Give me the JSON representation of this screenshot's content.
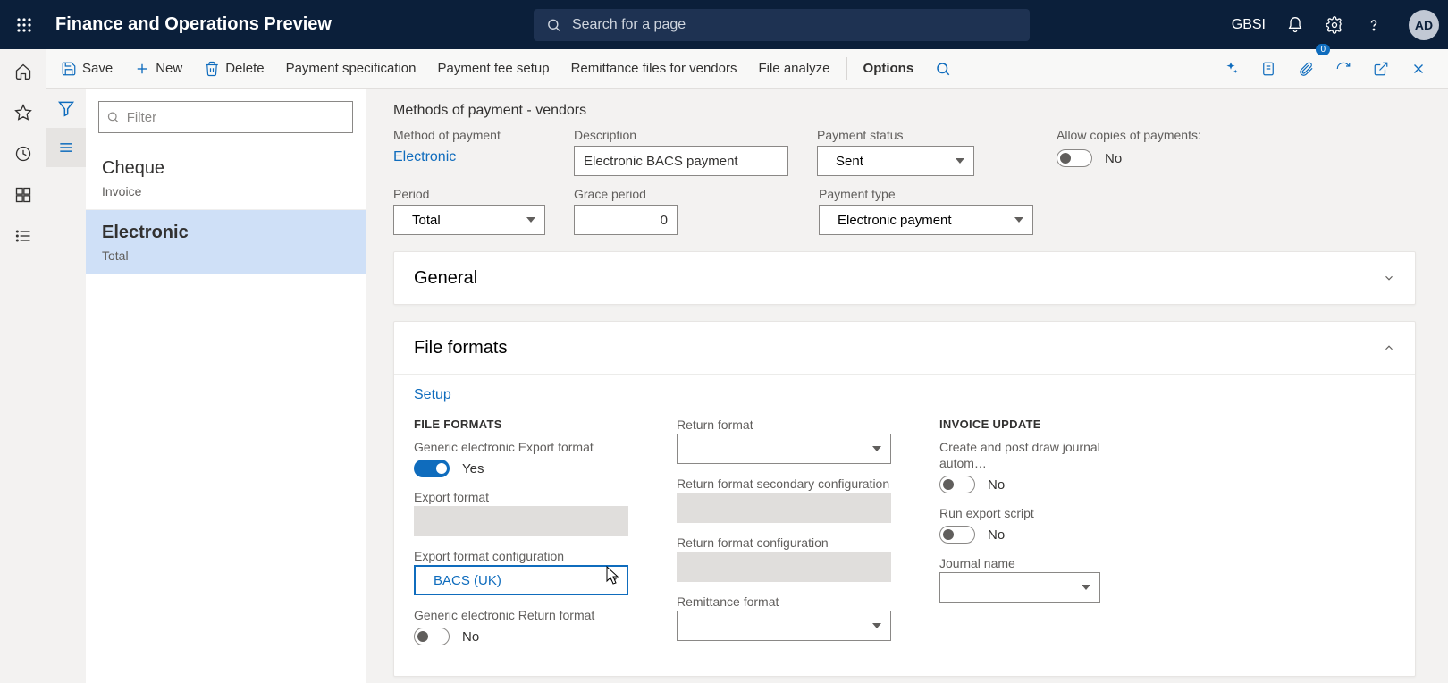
{
  "top": {
    "app_title": "Finance and Operations Preview",
    "search_placeholder": "Search for a page",
    "company": "GBSI",
    "avatar": "AD"
  },
  "actions": {
    "save": "Save",
    "new": "New",
    "delete": "Delete",
    "payment_spec": "Payment specification",
    "payment_fee": "Payment fee setup",
    "remittance": "Remittance files for vendors",
    "file_analyze": "File analyze",
    "options": "Options",
    "attach_badge": "0"
  },
  "list": {
    "filter_placeholder": "Filter",
    "items": [
      {
        "title": "Cheque",
        "sub": "Invoice"
      },
      {
        "title": "Electronic",
        "sub": "Total"
      }
    ],
    "selected_index": 1
  },
  "page": {
    "subtitle": "Methods of payment - vendors",
    "fields": {
      "method_label": "Method of payment",
      "method_value": "Electronic",
      "description_label": "Description",
      "description_value": "Electronic BACS payment",
      "payment_status_label": "Payment status",
      "payment_status_value": "Sent",
      "allow_copies_label": "Allow copies of payments:",
      "allow_copies_value": "No",
      "period_label": "Period",
      "period_value": "Total",
      "grace_label": "Grace period",
      "grace_value": "0",
      "payment_type_label": "Payment type",
      "payment_type_value": "Electronic payment"
    },
    "general_tab": "General",
    "file_formats_tab": "File formats",
    "setup_link": "Setup",
    "ff": {
      "section1": "FILE FORMATS",
      "generic_export_label": "Generic electronic Export format",
      "generic_export_value": "Yes",
      "export_format_label": "Export format",
      "export_format_value": "",
      "export_config_label": "Export format configuration",
      "export_config_value": "BACS (UK)",
      "generic_return_label": "Generic electronic Return format",
      "generic_return_value": "No",
      "return_format_label": "Return format",
      "return_format_value": "",
      "return_secondary_label": "Return format secondary configuration",
      "return_secondary_value": "",
      "return_config_label": "Return format configuration",
      "return_config_value": "",
      "remittance_label": "Remittance format",
      "remittance_value": "",
      "section2": "INVOICE UPDATE",
      "create_post_label": "Create and post draw journal autom…",
      "create_post_value": "No",
      "run_export_label": "Run export script",
      "run_export_value": "No",
      "journal_label": "Journal name",
      "journal_value": ""
    }
  }
}
